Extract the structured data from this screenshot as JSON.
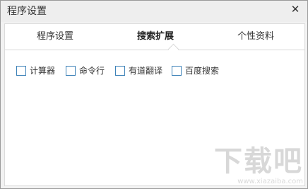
{
  "window": {
    "title": "程序设置",
    "close_glyph": "✕"
  },
  "tabs": [
    {
      "label": "程序设置",
      "active": false
    },
    {
      "label": "搜索扩展",
      "active": true
    },
    {
      "label": "个性资料",
      "active": false
    }
  ],
  "options": [
    {
      "label": "计算器",
      "checked": false
    },
    {
      "label": "命令行",
      "checked": false
    },
    {
      "label": "有道翻译",
      "checked": false
    },
    {
      "label": "百度搜索",
      "checked": false
    }
  ],
  "watermark": {
    "text": "下载吧",
    "url": "www.xiazaiba.com"
  },
  "colors": {
    "checkbox_border": "#3d82b8",
    "window_bg": "#f2f2f2"
  }
}
